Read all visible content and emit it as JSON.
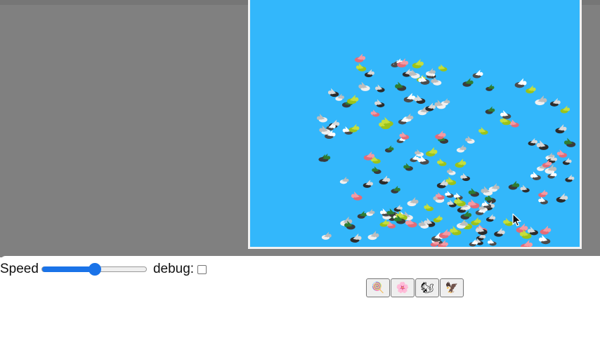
{
  "controls": {
    "speed_label": "Speed",
    "speed_fraction": 0.5,
    "debug_label": "debug:",
    "debug_checked": false
  },
  "toolbar": {
    "buttons": [
      {
        "name": "lollipop",
        "glyph": "🍭"
      },
      {
        "name": "flower",
        "glyph": "🌸"
      },
      {
        "name": "squirrel",
        "glyph": "🐿"
      },
      {
        "name": "bird",
        "glyph": "🦅"
      }
    ]
  },
  "colors": {
    "backdrop": "#808080",
    "sky": "#33b7fb",
    "accent": "#1a73e8"
  }
}
